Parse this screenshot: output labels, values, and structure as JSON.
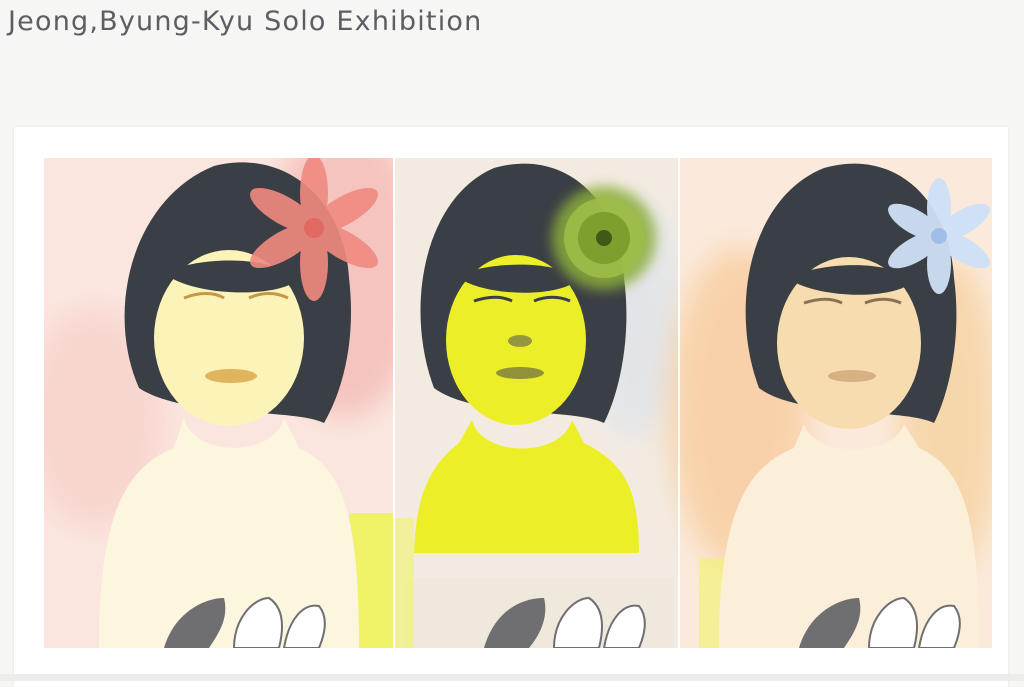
{
  "page": {
    "title": "Jeong,Byung-Kyu Solo Exhibition",
    "meta_lines": [
      "",
      "",
      "",
      ""
    ]
  },
  "artwork": {
    "panels": [
      {
        "name": "portrait-pink-flower",
        "flower": "pink lily",
        "accent": "#f08a80",
        "skin": "#fbf3b8",
        "bg": "#f6c9c4"
      },
      {
        "name": "portrait-green-flower",
        "flower": "green chrysanthemum",
        "accent": "#8cae3a",
        "skin": "#ecef28",
        "bg": "#f1e6d8"
      },
      {
        "name": "portrait-blue-flower",
        "flower": "pale blue lily",
        "accent": "#cfe1f7",
        "skin": "#f6dcae",
        "bg": "#f8cc9e"
      }
    ],
    "colors": {
      "hair": "#3a3e45",
      "paper": "#ffffff",
      "page_bg": "#f6f6f4",
      "title": "#5d5d63"
    }
  }
}
